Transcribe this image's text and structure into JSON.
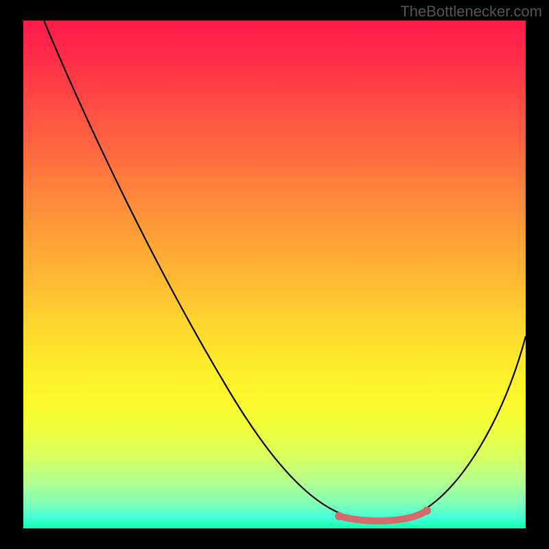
{
  "watermark": "TheBottlenecker.com",
  "chart_data": {
    "type": "line",
    "title": "",
    "xlabel": "",
    "ylabel": "",
    "xlim": [
      0,
      100
    ],
    "ylim": [
      0,
      100
    ],
    "x": [
      0,
      5,
      10,
      15,
      20,
      25,
      30,
      35,
      40,
      45,
      50,
      55,
      60,
      65,
      70,
      75,
      80,
      85,
      90,
      95,
      100
    ],
    "y": [
      100,
      93,
      85,
      76,
      67,
      58,
      49,
      40,
      31,
      23,
      15,
      9,
      5,
      2,
      1,
      1,
      2,
      5,
      11,
      21,
      36
    ],
    "highlight_range": {
      "x_start": 63,
      "x_end": 79,
      "y": 1.5
    },
    "background_gradient": {
      "top": "#ff1b4a",
      "mid": "#ffd030",
      "bottom": "#10ffa8"
    }
  }
}
